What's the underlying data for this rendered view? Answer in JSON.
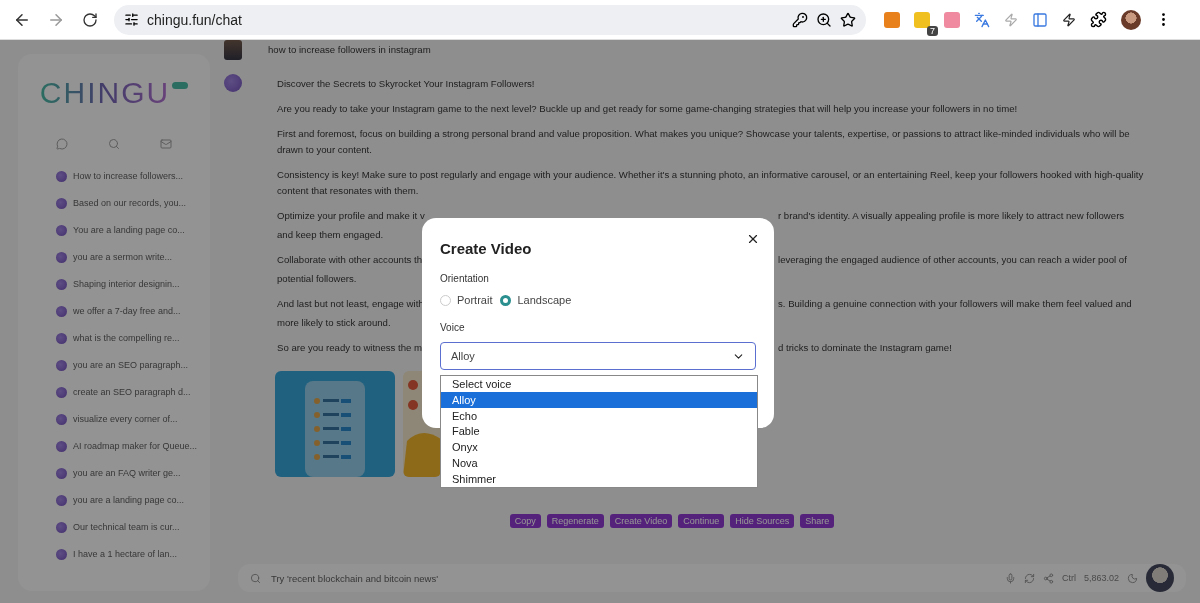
{
  "browser": {
    "url": "chingu.fun/chat",
    "extension_badge": "7"
  },
  "sidebar": {
    "logo": "CHINGU",
    "items": [
      "How to increase followers...",
      "Based on our records, you...",
      "You are a landing page co...",
      "you are a sermon write...",
      "Shaping interior designin...",
      "we offer a 7-day free and...",
      "what is the compelling re...",
      "you are an SEO paragraph...",
      "create an SEO paragraph d...",
      "visualize every corner of...",
      "AI roadmap maker for Queue...",
      "you are an FAQ writer ge...",
      "you are a landing page co...",
      "Our technical team is cur...",
      "I have a 1 hectare of lan..."
    ]
  },
  "chat": {
    "user_message": "how to increase followers in instagram",
    "reply_title": "Discover the Secrets to Skyrocket Your Instagram Followers!",
    "paragraphs": [
      {
        "kind": "full",
        "text": "Are you ready to take your Instagram game to the next level? Buckle up and get ready for some game-changing strategies that will help you increase your followers in no time!"
      },
      {
        "kind": "full",
        "text": "First and foremost, focus on building a strong personal brand and value proposition. What makes you unique? Showcase your talents, expertise, or passions to attract like-minded individuals who will be drawn to your content."
      },
      {
        "kind": "full",
        "text": "Consistency is key! Make sure to post regularly and engage with your audience. Whether it's a stunning photo, an informative carousel, or an entertaining Reel, keep your followers hooked with high-quality content that resonates with them."
      },
      {
        "kind": "split",
        "left": "Optimize your profile and make it v",
        "right": "r brand's identity. A visually appealing profile is more likely to attract new followers",
        "continuation": "and keep them engaged."
      },
      {
        "kind": "split",
        "left": "Collaborate with other accounts th",
        "right": "leveraging the engaged audience of other accounts, you can reach a wider pool of",
        "continuation": "potential followers."
      },
      {
        "kind": "split",
        "left": "And last but not least, engage with",
        "right": "s. Building a genuine connection with your followers will make them feel valued and",
        "continuation": "more likely to stick around."
      },
      {
        "kind": "split",
        "left": "So are you ready to witness the m",
        "right": "d tricks to dominate the Instagram game!"
      }
    ],
    "actions": [
      "Copy",
      "Regenerate",
      "Create Video",
      "Continue",
      "Hide Sources",
      "Share"
    ]
  },
  "input": {
    "placeholder": "Try 'recent blockchain and bitcoin news'",
    "shortcut": "Ctrl",
    "counter": "5,863.02"
  },
  "modal": {
    "title": "Create Video",
    "orientation_label": "Orientation",
    "orientations": [
      {
        "label": "Portrait",
        "selected": false
      },
      {
        "label": "Landscape",
        "selected": true
      }
    ],
    "voice_label": "Voice",
    "voice_value": "Alloy",
    "voice_options": [
      {
        "label": "Select voice",
        "selected": false
      },
      {
        "label": "Alloy",
        "selected": true
      },
      {
        "label": "Echo",
        "selected": false
      },
      {
        "label": "Fable",
        "selected": false
      },
      {
        "label": "Onyx",
        "selected": false
      },
      {
        "label": "Nova",
        "selected": false
      },
      {
        "label": "Shimmer",
        "selected": false
      }
    ]
  }
}
